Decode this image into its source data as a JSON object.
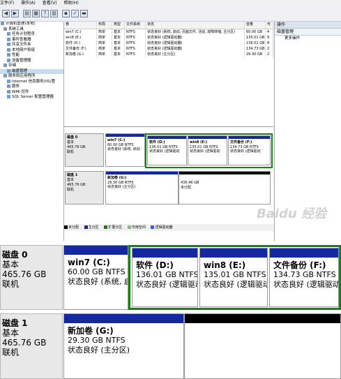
{
  "menu": [
    "文件(F)",
    "操作(A)",
    "查看(V)",
    "帮助(H)"
  ],
  "tree": [
    {
      "label": "计算机管理(本地)",
      "indent": 0
    },
    {
      "label": "系统工具",
      "indent": 1
    },
    {
      "label": "任务计划程序",
      "indent": 2
    },
    {
      "label": "事件查看器",
      "indent": 2
    },
    {
      "label": "共享文件夹",
      "indent": 2
    },
    {
      "label": "本地用户和组",
      "indent": 2
    },
    {
      "label": "性能",
      "indent": 2
    },
    {
      "label": "设备管理器",
      "indent": 2
    },
    {
      "label": "存储",
      "indent": 1
    },
    {
      "label": "磁盘管理",
      "indent": 2,
      "selected": true
    },
    {
      "label": "服务和应用程序",
      "indent": 1
    },
    {
      "label": "Internet 信息服务(IIS)管",
      "indent": 2
    },
    {
      "label": "服务",
      "indent": 2
    },
    {
      "label": "WMI 控件",
      "indent": 2
    },
    {
      "label": "SQL Server 配置管理器",
      "indent": 2
    }
  ],
  "volume_table": {
    "headers": [
      "卷",
      "布局",
      "类型",
      "文件系统",
      "状态",
      "容量",
      "可"
    ],
    "rows": [
      [
        "win7 (C:)",
        "简单",
        "基本",
        "NTFS",
        "状态良好 (系统, 启动, 页面文件, 活动, 故障转储, 主分区)",
        "60.00 GB",
        "4"
      ],
      [
        "win8 (E:)",
        "简单",
        "基本",
        "NTFS",
        "状态良好 (逻辑驱动器)",
        "135.01 GB",
        "9"
      ],
      [
        "软件 (D:)",
        "简单",
        "基本",
        "NTFS",
        "状态良好 (逻辑驱动器)",
        "136.01 GB",
        "8"
      ],
      [
        "文件备份 (F:)",
        "简单",
        "基本",
        "NTFS",
        "状态良好 (逻辑驱动器)",
        "134.73 GB",
        "2"
      ],
      [
        "新加卷 (G:)",
        "简单",
        "基本",
        "NTFS",
        "状态良好 (主分区)",
        "29.30 GB",
        "2"
      ]
    ]
  },
  "disks": [
    {
      "name": "磁盘 0",
      "type": "基本",
      "size": "465.76 GB",
      "status": "联机",
      "partitions": [
        {
          "name": "win7 (C:)",
          "size": "60.00 GB NTFS",
          "status": "状态良好 (系统, 启动"
        },
        {
          "name": "软件 (D:)",
          "size": "136.01 GB NTFS",
          "status": "状态良好 (逻辑驱动"
        },
        {
          "name": "win8 (E:)",
          "size": "135.01 GB NTFS",
          "status": "状态良好 (逻辑驱动"
        },
        {
          "name": "文件备份 (F:)",
          "size": "134.73 GB NTFS",
          "status": "状态良好 (逻辑驱动"
        }
      ]
    },
    {
      "name": "磁盘 1",
      "type": "基本",
      "size": "465.76 GB",
      "status": "联机",
      "partitions": [
        {
          "name": "新加卷 (G:)",
          "size": "29.30 GB NTFS",
          "status": "状态良好 (主分区)"
        },
        {
          "name": "",
          "size": "436.46 GB",
          "status": "未分配"
        }
      ]
    }
  ],
  "legend": [
    {
      "label": "未分配",
      "color": "#000000"
    },
    {
      "label": "主分区",
      "color": "#1428a0"
    },
    {
      "label": "扩展分区",
      "color": "#1b7d1b"
    },
    {
      "label": "可用空间",
      "color": "#7cc47c"
    },
    {
      "label": "逻辑驱动器",
      "color": "#3a5fcd"
    }
  ],
  "actions": {
    "header": "操作",
    "section": "磁盘管理",
    "more": "更多操作"
  },
  "watermark": "Baidu 经验"
}
